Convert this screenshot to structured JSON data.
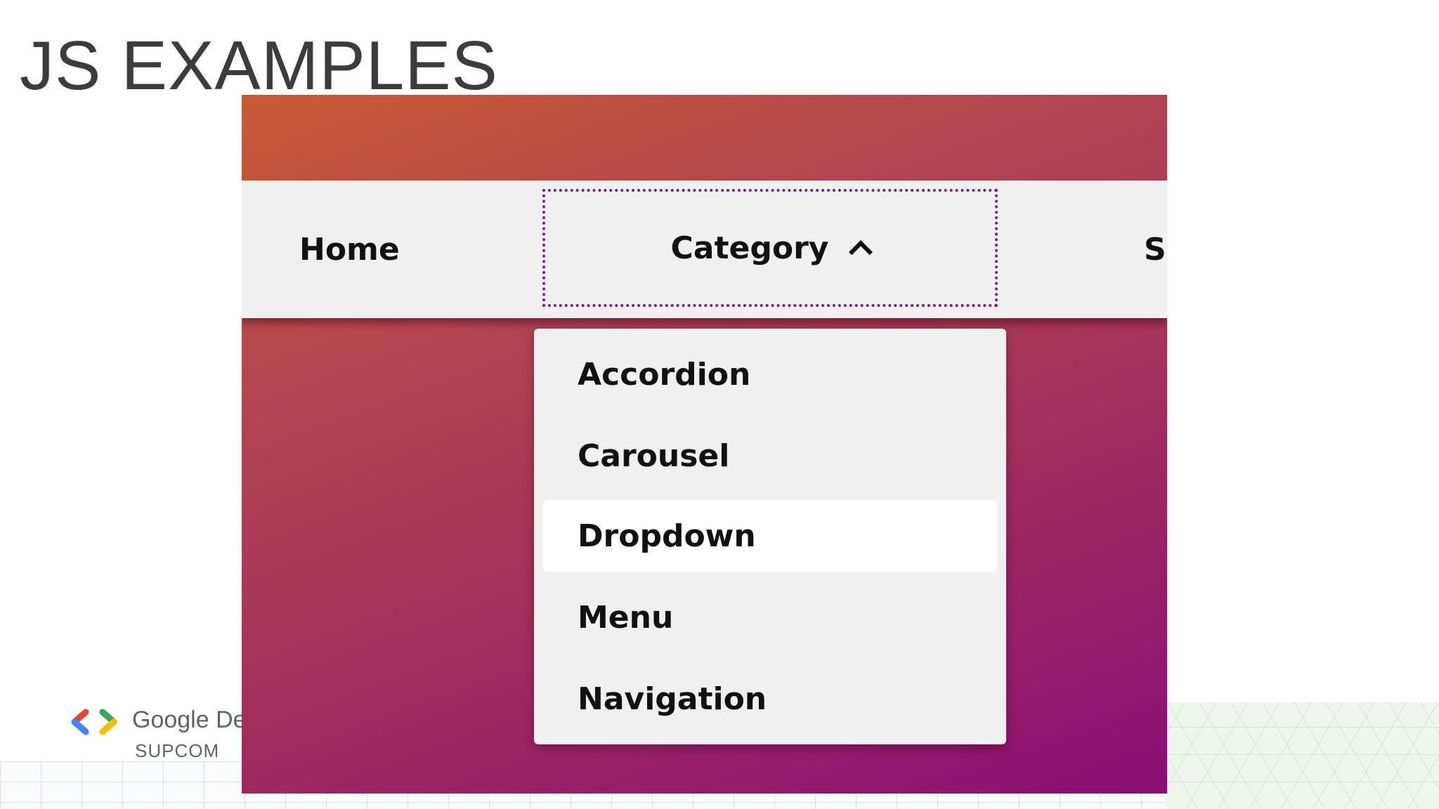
{
  "slide": {
    "title": "JS EXAMPLES"
  },
  "brand": {
    "name": "Google De",
    "sub": "SUPCOM",
    "logo_icon": "google-developers-chevrons-icon"
  },
  "demo": {
    "nav": {
      "home_label": "Home",
      "category_label": "Category",
      "services_label_visible": "Se",
      "category_caret_icon": "chevron-up-icon"
    },
    "dropdown": {
      "items": [
        {
          "label": "Accordion"
        },
        {
          "label": "Carousel"
        },
        {
          "label": "Dropdown",
          "active": true
        },
        {
          "label": "Menu"
        },
        {
          "label": "Navigation"
        }
      ]
    },
    "colors": {
      "gradient_start": "#c85a34",
      "gradient_end": "#8a0d76",
      "nav_bg": "#f0f0f0",
      "focus_outline": "#7b1a8a"
    }
  }
}
